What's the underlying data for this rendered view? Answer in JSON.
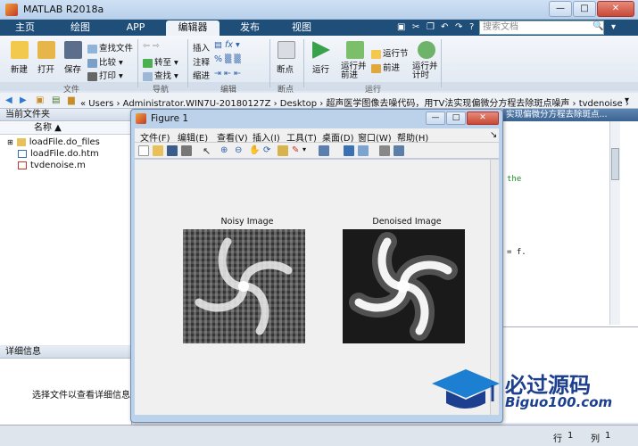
{
  "window": {
    "title": "MATLAB R2018a",
    "minimize": "—",
    "maximize": "□",
    "close": "✕"
  },
  "tabs": [
    {
      "label": "主页"
    },
    {
      "label": "绘图"
    },
    {
      "label": "APP"
    },
    {
      "label": "编辑器"
    },
    {
      "label": "发布"
    },
    {
      "label": "视图"
    }
  ],
  "search": {
    "placeholder": "搜索文档"
  },
  "ribbon": {
    "new": "新建",
    "open": "打开",
    "save": "保存",
    "find_files": "查找文件",
    "compare": "比较",
    "print": "打印",
    "goto": "转至",
    "find": "查找",
    "insert": "插入",
    "comment": "注释",
    "indent": "缩进",
    "breakpoints": "断点",
    "run": "运行",
    "run_advance": "运行并\n前进",
    "run_section": "运行节",
    "advance": "前进",
    "run_time": "运行并\n计时",
    "group_file": "文件",
    "group_nav": "导航",
    "group_edit": "编辑",
    "group_bp": "断点",
    "group_run": "运行"
  },
  "address": {
    "path": "«  Users  ›  Administrator.WIN7U-20180127Z  ›  Desktop  ›  超声医学图像去噪代码，用TV法实现偏微分方程去除斑点噪声  ›  tvdenoise  ›"
  },
  "current_folder": {
    "title": "当前文件夹",
    "col_name": "名称 ▲",
    "files": [
      {
        "name": "loadFile.do_files",
        "type": "folder"
      },
      {
        "name": "loadFile.do.htm",
        "type": "html"
      },
      {
        "name": "tvdenoise.m",
        "type": "m"
      }
    ]
  },
  "details": {
    "title": "详细信息",
    "hint": "选择文件以查看详细信息"
  },
  "editor": {
    "tab_title": "实现偏微分方程去除斑点...",
    "frag1": "the",
    "frag2": "= f."
  },
  "figure": {
    "title": "Figure 1",
    "menu": [
      "文件(F)",
      "编辑(E)",
      "查看(V)",
      "插入(I)",
      "工具(T)",
      "桌面(D)",
      "窗口(W)",
      "帮助(H)"
    ],
    "plots": [
      {
        "title": "Noisy Image"
      },
      {
        "title": "Denoised Image"
      }
    ]
  },
  "status": {
    "row_label": "行",
    "row": "1",
    "col_label": "列",
    "col": "1"
  },
  "logo": {
    "cn": "必过源码",
    "en": "Biguo100.com"
  },
  "colors": {
    "accent": "#1f4e79",
    "logo": "#1d3f8f"
  }
}
